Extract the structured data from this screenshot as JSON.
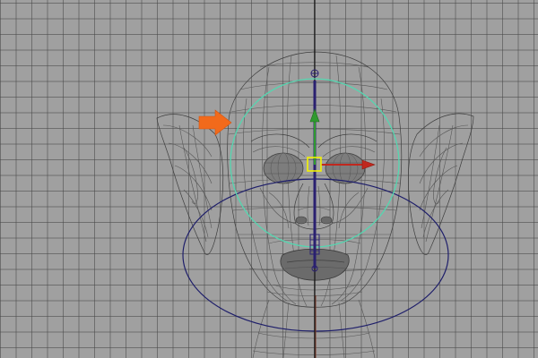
{
  "viewport": {
    "label": "3D viewport",
    "grid_color": "#464646",
    "background_color": "#a0a0a0"
  },
  "model": {
    "name": "goblin-head-wireframe",
    "wire_color": "#3e3e3e"
  },
  "gizmo": {
    "y_axis_color": "#2f9a2f",
    "x_axis_color": "#c0281e",
    "pivot_color": "#f2f200"
  },
  "controls": {
    "eye_ring_color": "#55d6b0",
    "base_ring_color": "#1e1e6a",
    "axis_line_color": "#141414"
  },
  "annotation": {
    "arrow_color": "#f26a1b",
    "arrow_target": "eye-control-ring"
  }
}
